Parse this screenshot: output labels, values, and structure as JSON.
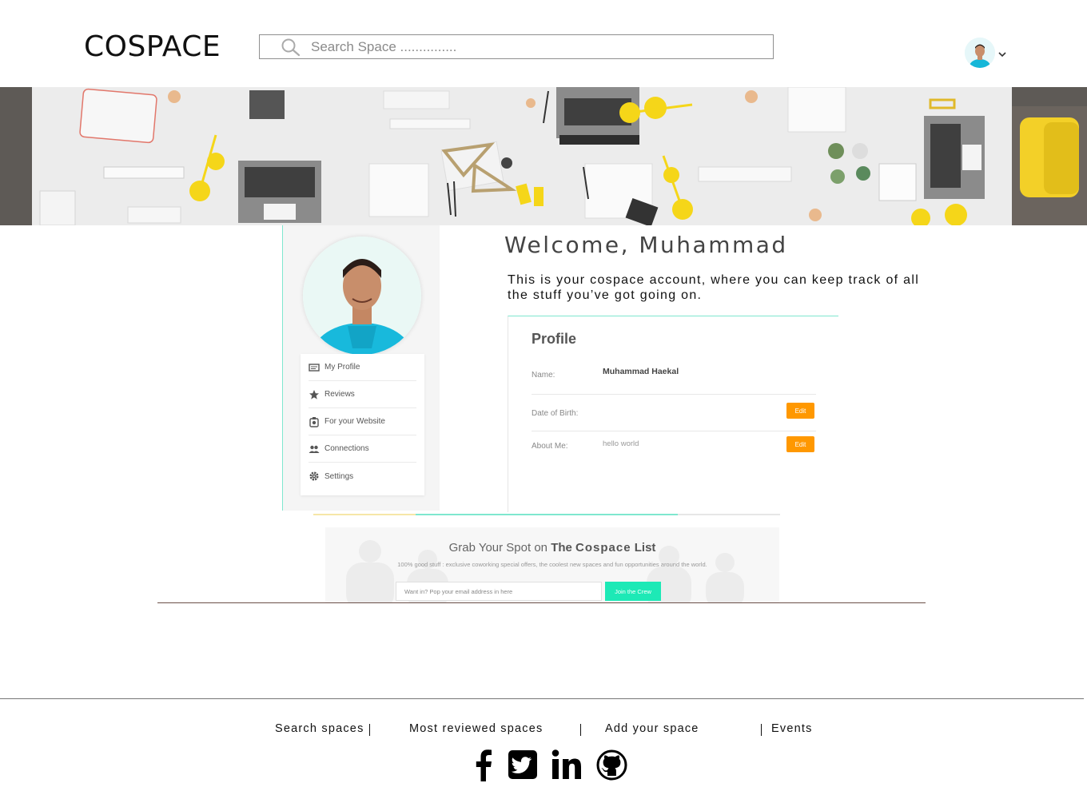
{
  "header": {
    "logo": "COSPACE",
    "search": {
      "placeholder": "Search Space ..............."
    }
  },
  "sidebar": {
    "menu": [
      {
        "label": "My Profile",
        "icon": "id-card-icon"
      },
      {
        "label": "Reviews",
        "icon": "star-icon"
      },
      {
        "label": "For your Website",
        "icon": "badge-icon"
      },
      {
        "label": "Connections",
        "icon": "users-icon"
      },
      {
        "label": "Settings",
        "icon": "gear-icon"
      }
    ]
  },
  "welcome": {
    "title": "Welcome, Muhammad",
    "text": "This is your cospace account, where you can keep track of all the stuff you’ve got going on."
  },
  "profile": {
    "title": "Profile",
    "rows": [
      {
        "label": "Name:",
        "value": "Muhammad Haekal"
      },
      {
        "label": "Date of Birth:",
        "value": "",
        "action": "Edit"
      },
      {
        "label": "About Me:",
        "value": "hello world",
        "action": "Edit"
      }
    ]
  },
  "newsletter": {
    "title_prefix": "Grab Your Spot on",
    "title_the": "The",
    "title_brand": "Cospace",
    "title_list": "List",
    "subtitle": "100% good stuff : exclusive coworking special offers, the coolest new spaces and fun opportunities around the world.",
    "input_placeholder": "Want in? Pop your email address in here",
    "button": "Join the Crew"
  },
  "footer": {
    "links": [
      "Search spaces",
      "Most reviewed spaces",
      "Add your space",
      "Events"
    ],
    "social": [
      "facebook-icon",
      "twitter-icon",
      "linkedin-icon",
      "github-icon"
    ]
  },
  "colors": {
    "accent": "#1de9b6",
    "edit": "#ff9800",
    "banner_yellow": "#f5d619"
  }
}
